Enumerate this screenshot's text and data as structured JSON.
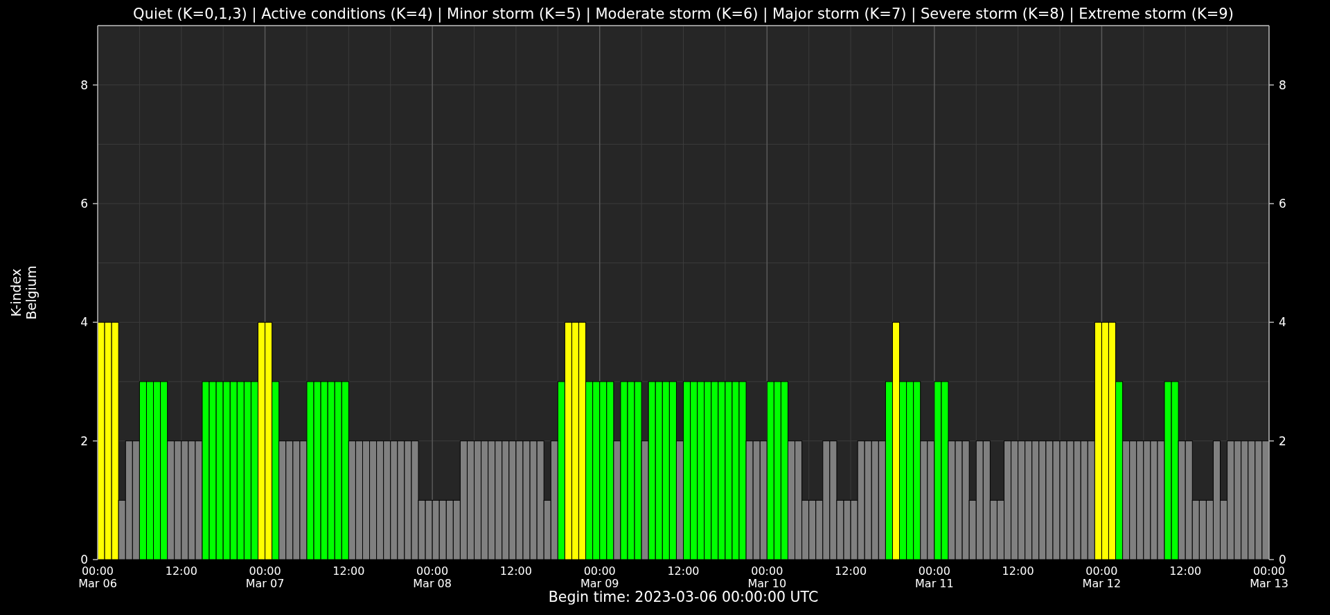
{
  "chart": {
    "chart_data": {
      "type": "bar",
      "title": "Quiet (K=0,1,3) | Active conditions (K=4) | Minor storm (K=5) | Moderate storm (K=6) | Major storm (K=7) | Severe storm (K=8) | Extreme storm (K=9)",
      "xlabel": "Begin time: 2023-03-06 00:00:00 UTC",
      "ylabel": "K-index\nBelgium",
      "grid": true,
      "ylim": [
        0,
        9
      ],
      "yticks": [
        0,
        2,
        4,
        6,
        8
      ],
      "categories": [
        "00:00\nMar 06",
        null,
        null,
        null,
        null,
        null,
        null,
        null,
        null,
        null,
        null,
        null,
        "12:00",
        null,
        null,
        null,
        null,
        null,
        null,
        null,
        null,
        null,
        null,
        null,
        "00:00\nMar 07",
        null,
        null,
        null,
        null,
        null,
        null,
        null,
        null,
        null,
        null,
        null,
        "12:00",
        null,
        null,
        null,
        null,
        null,
        null,
        null,
        null,
        null,
        null,
        null,
        "00:00\nMar 08",
        null,
        null,
        null,
        null,
        null,
        null,
        null,
        null,
        null,
        null,
        null,
        "12:00",
        null,
        null,
        null,
        null,
        null,
        null,
        null,
        null,
        null,
        null,
        null,
        "00:00\nMar 09",
        null,
        null,
        null,
        null,
        null,
        null,
        null,
        null,
        null,
        null,
        null,
        "12:00",
        null,
        null,
        null,
        null,
        null,
        null,
        null,
        null,
        null,
        null,
        null,
        "00:00\nMar 10",
        null,
        null,
        null,
        null,
        null,
        null,
        null,
        null,
        null,
        null,
        null,
        "12:00",
        null,
        null,
        null,
        null,
        null,
        null,
        null,
        null,
        null,
        null,
        null,
        "00:00\nMar 11",
        null,
        null,
        null,
        null,
        null,
        null,
        null,
        null,
        null,
        null,
        null,
        "12:00",
        null,
        null,
        null,
        null,
        null,
        null,
        null,
        null,
        null,
        null,
        null,
        "00:00\nMar 12",
        null,
        null,
        null,
        null,
        null,
        null,
        null,
        null,
        null,
        null,
        null,
        "12:00",
        null,
        null,
        null,
        null,
        null,
        null,
        null,
        null,
        null,
        null,
        null
      ],
      "values": [
        4,
        4,
        4,
        1,
        2,
        2,
        3,
        3,
        3,
        3,
        2,
        2,
        2,
        2,
        2,
        3,
        3,
        3,
        3,
        3,
        3,
        3,
        3,
        4,
        4,
        3,
        2,
        2,
        2,
        2,
        3,
        3,
        3,
        3,
        3,
        3,
        2,
        2,
        2,
        2,
        2,
        2,
        2,
        2,
        2,
        2,
        1,
        1,
        1,
        1,
        1,
        1,
        2,
        2,
        2,
        2,
        2,
        2,
        2,
        2,
        2,
        2,
        2,
        2,
        1,
        2,
        3,
        4,
        4,
        4,
        3,
        3,
        3,
        3,
        2,
        3,
        3,
        3,
        2,
        3,
        3,
        3,
        3,
        2,
        3,
        3,
        3,
        3,
        3,
        3,
        3,
        3,
        3,
        2,
        2,
        2,
        3,
        3,
        3,
        2,
        2,
        1,
        1,
        1,
        2,
        2,
        1,
        1,
        1,
        2,
        2,
        2,
        2,
        3,
        4,
        3,
        3,
        3,
        2,
        2,
        3,
        3,
        2,
        2,
        2,
        1,
        2,
        2,
        1,
        1,
        2,
        2,
        2,
        2,
        2,
        2,
        2,
        2,
        2,
        2,
        2,
        2,
        2,
        4,
        4,
        4,
        3,
        2,
        2,
        2,
        2,
        2,
        2,
        3,
        3,
        2,
        2,
        1,
        1,
        1,
        2,
        1,
        2,
        2,
        2,
        2,
        2,
        2
      ]
    },
    "axis_end_label": "00:00\nMar 13",
    "right_axis_labels": [
      "8",
      "6",
      "4",
      "2",
      "0"
    ]
  }
}
